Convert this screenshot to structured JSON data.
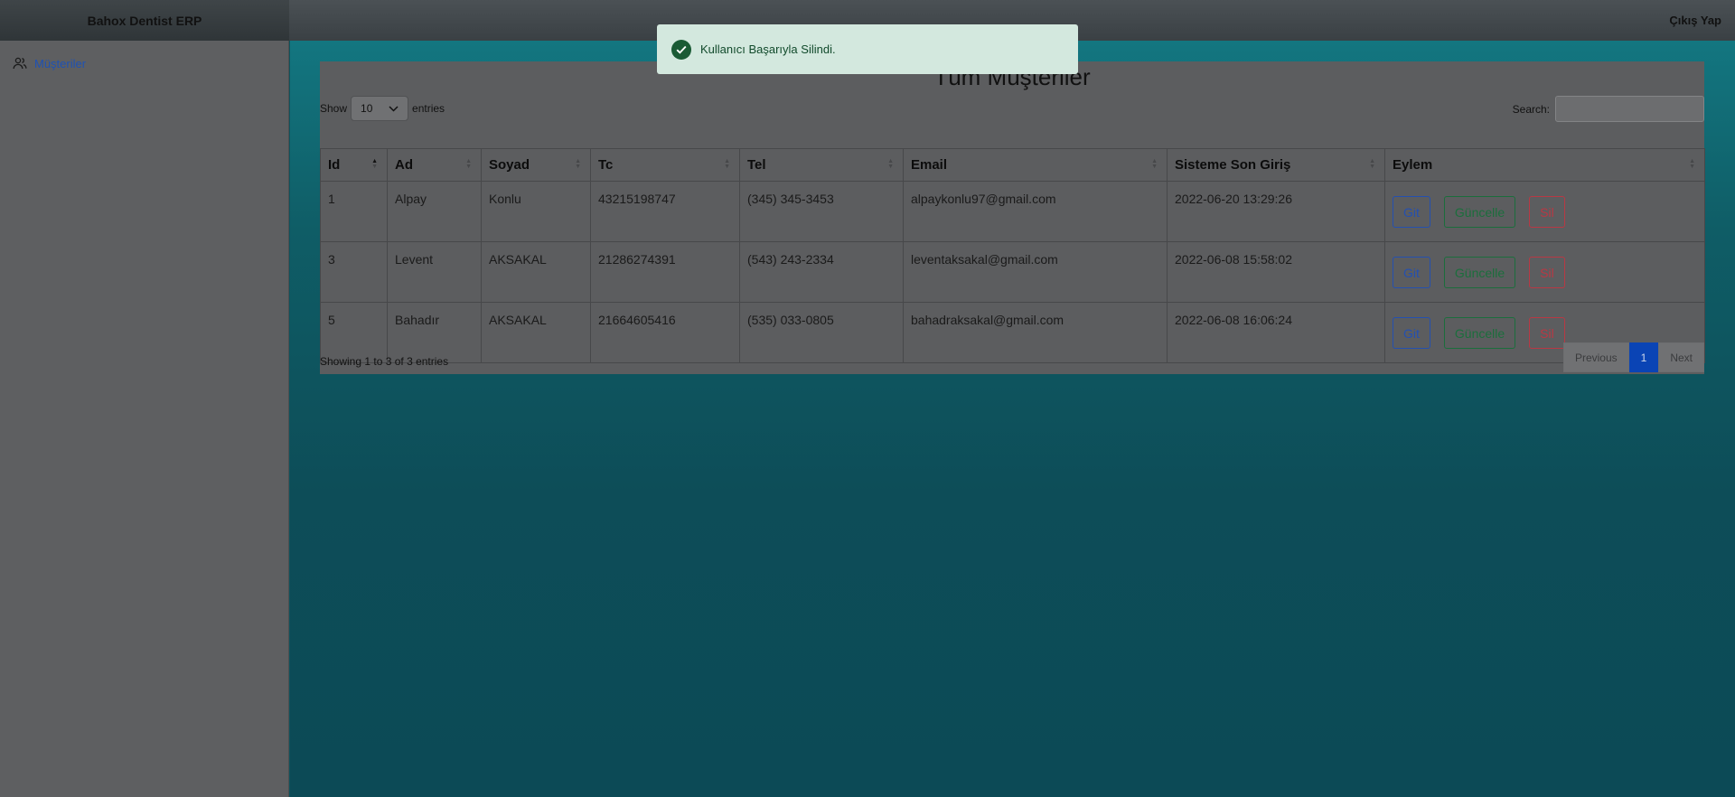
{
  "app": {
    "brand": "Bahox Dentist ERP",
    "logout": "Çıkış Yap"
  },
  "sidebar": {
    "items": [
      {
        "label": "Müşteriler",
        "icon": "users-icon"
      }
    ]
  },
  "page": {
    "title": "Tüm Müşteriler"
  },
  "datatable": {
    "show_label": "Show",
    "entries_label": "entries",
    "page_length": "10",
    "search_label": "Search:",
    "search_value": "",
    "columns": [
      "Id",
      "Ad",
      "Soyad",
      "Tc",
      "Tel",
      "Email",
      "Sisteme Son Giriş",
      "Eylem"
    ],
    "rows": [
      {
        "id": "1",
        "ad": "Alpay",
        "soyad": "Konlu",
        "tc": "43215198747",
        "tel": "(345) 345-3453",
        "email": "alpaykonlu97@gmail.com",
        "last_login": "2022-06-20 13:29:26"
      },
      {
        "id": "3",
        "ad": "Levent",
        "soyad": "AKSAKAL",
        "tc": "21286274391",
        "tel": "(543) 243-2334",
        "email": "leventaksakal@gmail.com",
        "last_login": "2022-06-08 15:58:02"
      },
      {
        "id": "5",
        "ad": "Bahadır",
        "soyad": "AKSAKAL",
        "tc": "21664605416",
        "tel": "(535) 033-0805",
        "email": "bahadraksakal@gmail.com",
        "last_login": "2022-06-08 16:06:24"
      }
    ],
    "actions": {
      "go": "Git",
      "update": "Güncelle",
      "delete": "Sil"
    },
    "info": "Showing 1 to 3 of 3 entries",
    "pager": {
      "previous": "Previous",
      "current": "1",
      "next": "Next"
    }
  },
  "toast": {
    "message": "Kullanıcı Başarıyla Silindi.",
    "type": "success"
  },
  "colors": {
    "toast_bg": "#d3e8de",
    "toast_icon": "#1a5b35",
    "primary": "#0a44b5",
    "link": "#1f52b3"
  }
}
